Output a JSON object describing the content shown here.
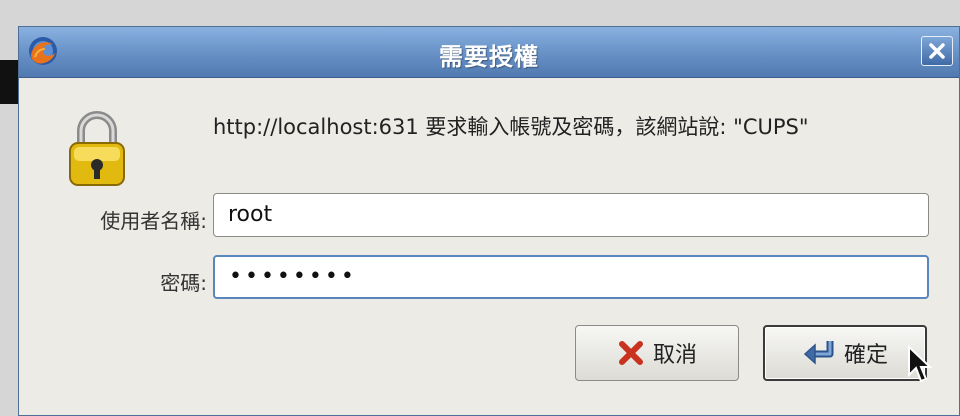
{
  "dialog": {
    "title": "需要授權",
    "message": "http://localhost:631 要求輸入帳號及密碼，該網站說: \"CUPS\"",
    "username_label": "使用者名稱:",
    "username_value": "root",
    "password_label": "密碼:",
    "password_value": "••••••••",
    "cancel_label": "取消",
    "ok_label": "確定"
  },
  "colors": {
    "titlebar": "#6c96ca",
    "dialog_bg": "#ecebe6",
    "focus_border": "#5b86bd",
    "cancel_icon": "#c8321e",
    "ok_icon": "#3f6aa6"
  },
  "icons": {
    "app": "firefox-icon",
    "close": "close-icon",
    "lock": "lock-icon",
    "cancel": "x-icon",
    "ok": "enter-arrow-icon",
    "pointer": "mouse-cursor-icon"
  }
}
